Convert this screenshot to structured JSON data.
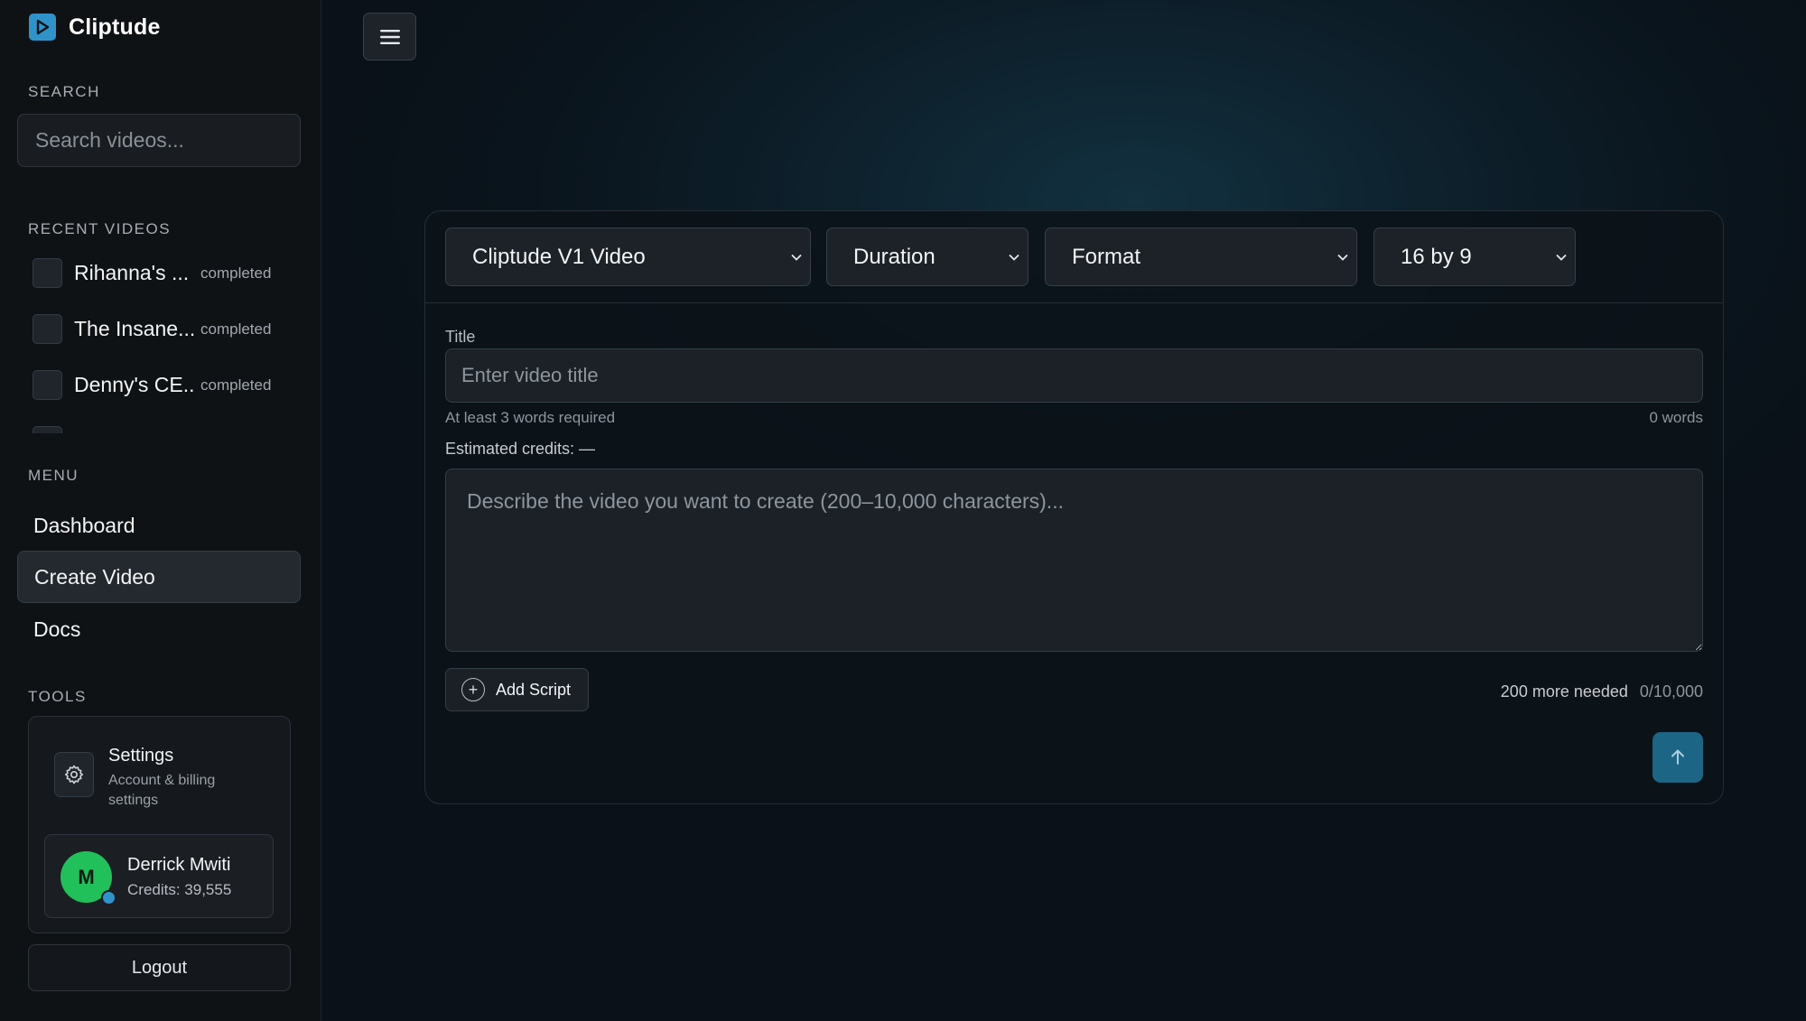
{
  "app": {
    "name": "Cliptude"
  },
  "sidebar": {
    "search_label": "SEARCH",
    "search_placeholder": "Search videos...",
    "recent_label": "RECENT VIDEOS",
    "recent_videos": [
      {
        "title": "Rihanna's ...",
        "status": "completed"
      },
      {
        "title": "The Insane...",
        "status": "completed"
      },
      {
        "title": "Denny's CE...",
        "status": "completed"
      }
    ],
    "menu_label": "MENU",
    "menu": [
      {
        "label": "Dashboard",
        "active": false
      },
      {
        "label": "Create Video",
        "active": true
      },
      {
        "label": "Docs",
        "active": false
      }
    ],
    "tools_label": "TOOLS",
    "settings": {
      "title": "Settings",
      "subtitle": "Account & billing settings"
    },
    "user": {
      "initial": "M",
      "name": "Derrick Mwiti",
      "credits": "Credits: 39,555"
    },
    "logout_label": "Logout"
  },
  "composer": {
    "model_select": "Cliptude V1 Video",
    "duration_select": "Duration",
    "format_select": "Format",
    "aspect_select": "16 by 9",
    "title_label": "Title",
    "title_placeholder": "Enter video title",
    "title_hint": "At least 3 words required",
    "word_count": "0 words",
    "estimated_credits": "Estimated credits: —",
    "description_placeholder": "Describe the video you want to create (200–10,000 characters)...",
    "add_script_label": "Add Script",
    "more_needed": "200 more needed",
    "char_count": "0/10,000"
  },
  "colors": {
    "accent": "#2f93c9",
    "submit": "#1d6585",
    "avatar": "#22c05a"
  }
}
